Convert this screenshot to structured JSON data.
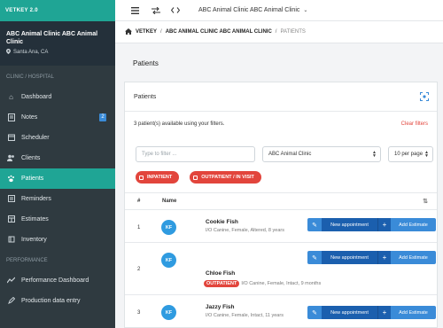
{
  "app": {
    "brand": "VETKEY 2.0"
  },
  "sidebar": {
    "clinic_name": "ABC Animal Clinic ABC Animal Clinic",
    "clinic_location": "Santa Ana, CA",
    "section_clinic": "CLINIC / HOSPITAL",
    "section_performance": "PERFORMANCE",
    "items": [
      {
        "label": "Dashboard",
        "icon": "home-icon"
      },
      {
        "label": "Notes",
        "icon": "notes-icon",
        "badge": "2"
      },
      {
        "label": "Scheduler",
        "icon": "calendar-icon"
      },
      {
        "label": "Clients",
        "icon": "users-icon"
      },
      {
        "label": "Patients",
        "icon": "paw-icon",
        "active": true
      },
      {
        "label": "Reminders",
        "icon": "bell-icon"
      },
      {
        "label": "Estimates",
        "icon": "calculator-icon"
      },
      {
        "label": "Inventory",
        "icon": "box-icon"
      }
    ],
    "perf_items": [
      {
        "label": "Performance Dashboard",
        "icon": "chart-icon"
      },
      {
        "label": "Production data entry",
        "icon": "edit-icon"
      }
    ]
  },
  "topbar": {
    "clinic_selector": "ABC Animal Clinic ABC Animal Clinic"
  },
  "breadcrumb": {
    "root": "VETKEY",
    "sep": "/",
    "clinic": "ABC ANIMAL CLINIC ABC ANIMAL CLINIC",
    "current": "PATIENTS"
  },
  "page": {
    "title": "Patients"
  },
  "card": {
    "title": "Patients",
    "summary": "3 patient(s) available using your filters.",
    "clear_filters": "Clear filters",
    "filter_placeholder": "Type to filter ...",
    "clinic_select": "ABC Animal Clinic",
    "per_page": "10 per page",
    "tags": [
      "INPATIENT",
      "OUTPATIENT / IN VISIT"
    ]
  },
  "table": {
    "col_num": "#",
    "col_name": "Name",
    "rows": [
      {
        "num": "1",
        "initials": "KF",
        "name": "Cookie Fish",
        "desc": "I/O Canine, Female, Altered, 8 years",
        "status": ""
      },
      {
        "num": "2",
        "initials": "KF",
        "name": "Chloe Fish",
        "desc": "I/O Canine, Female, Intact, 9 months",
        "status": "OUTPATIENT"
      },
      {
        "num": "3",
        "initials": "KF",
        "name": "Jazzy Fish",
        "desc": "I/O Canine, Female, Intact, 11 years",
        "status": ""
      }
    ],
    "btn_new": "New appointment",
    "btn_estimate": "Add Estimate"
  }
}
